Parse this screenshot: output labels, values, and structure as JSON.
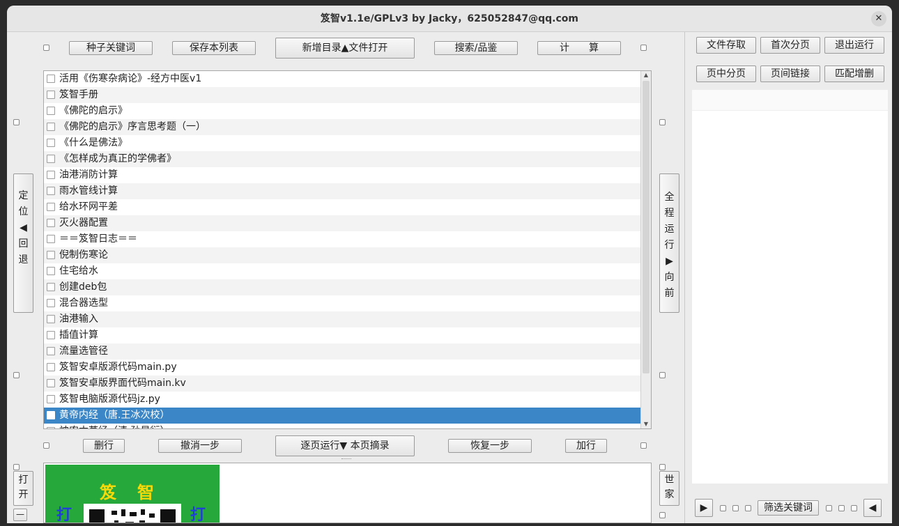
{
  "window": {
    "title": "笈智v1.1e/GPLv3 by Jacky，625052847@qq.com",
    "close_glyph": "✕"
  },
  "toolbar_top": {
    "seed_keywords": "种子关键词",
    "save_list": "保存本列表",
    "new_dir_open": "新增目录▲文件打开",
    "search_appraise": "搜索/品鉴",
    "compute": "计　　算"
  },
  "left_nav": {
    "locate_back": [
      "定",
      "位",
      "◀",
      "回",
      "退"
    ],
    "open": [
      "打",
      "开"
    ],
    "minus": "—"
  },
  "right_nav": {
    "run_all_forward": [
      "全",
      "程",
      "运",
      "行",
      "▶",
      "向",
      "前"
    ],
    "world_home": [
      "世",
      "家"
    ]
  },
  "list": {
    "items": [
      "活用《伤寒杂病论》-经方中医v1",
      "笈智手册",
      "《佛陀的启示》",
      "《佛陀的启示》序言思考题（一）",
      "《什么是佛法》",
      "《怎样成为真正的学佛者》",
      "油港消防计算",
      "雨水管线计算",
      "给水环网平差",
      "灭火器配置",
      "＝＝笈智日志＝＝",
      "倪制伤寒论",
      "住宅给水",
      "创建deb包",
      "混合器选型",
      "油港输入",
      "插值计算",
      "流量选管径",
      "笈智安卓版源代码main.py",
      "笈智安卓版界面代码main.kv",
      "笈智电脑版源代码jz.py",
      "黄帝内经（唐.王冰次校）",
      "神农本草经（清.孙星衍）"
    ],
    "selected_index": 21
  },
  "toolbar_bottom": {
    "delete_row": "删行",
    "undo": "撤消一步",
    "page_run_summary": "逐页运行▼ 本页摘录",
    "redo": "恢复一步",
    "add_row": "加行"
  },
  "banner": {
    "title": "笈智",
    "left_char": "打",
    "right_char": "打",
    "colors": {
      "bg": "#26a83a",
      "title": "#f5d90a",
      "side": "#1f3fd6"
    }
  },
  "right_panel": {
    "file_save": "文件存取",
    "first_page": "首次分页",
    "exit_run": "退出运行",
    "mid_page": "页中分页",
    "page_link": "页间链接",
    "match_edit": "匹配增删",
    "play": "▶",
    "filter_keywords": "筛选关键词",
    "back": "◀"
  },
  "colors": {
    "selection": "#3a86c6",
    "window_bg": "#ececec"
  }
}
